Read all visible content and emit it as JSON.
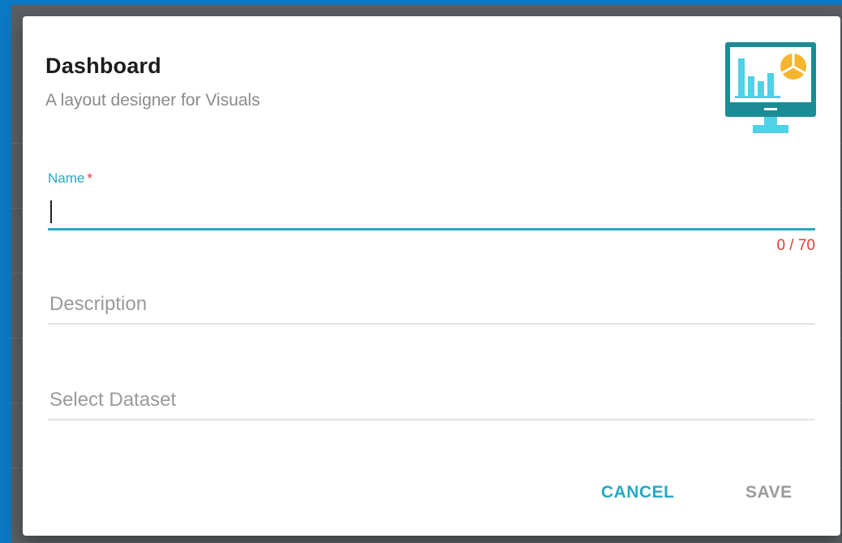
{
  "dialog": {
    "title": "Dashboard",
    "subtitle": "A layout designer for Visuals",
    "illustration_icon": "monitor-chart-icon"
  },
  "form": {
    "name": {
      "label": "Name",
      "required_marker": "*",
      "value": "",
      "counter": "0 / 70"
    },
    "description": {
      "placeholder": "Description",
      "value": ""
    },
    "dataset": {
      "placeholder": "Select Dataset",
      "value": ""
    }
  },
  "actions": {
    "cancel_label": "CANCEL",
    "save_label": "SAVE"
  },
  "colors": {
    "accent": "#26a9c4",
    "error": "#e53935",
    "muted": "#9a9a9a",
    "background": "#0a78c2",
    "monitor_body": "#1b8c96",
    "chart_bars": "#4fd1e6",
    "pie": "#f5b52e"
  }
}
